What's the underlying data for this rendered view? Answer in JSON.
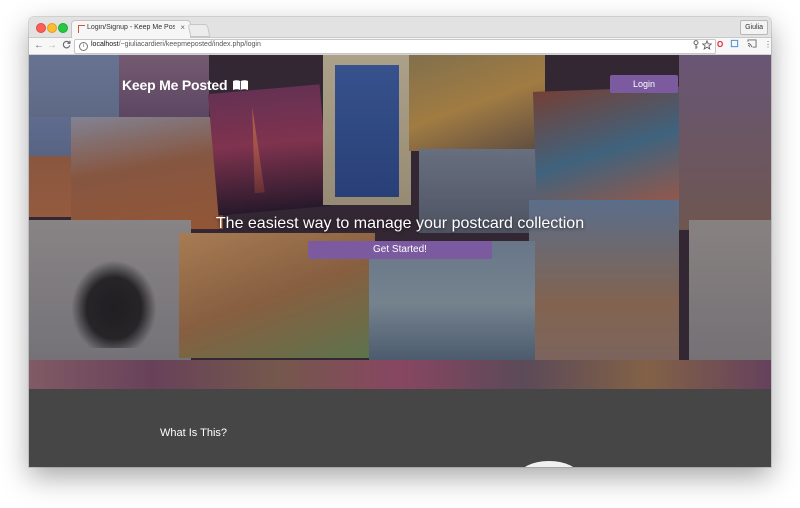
{
  "browser": {
    "tab_title": "Login/Signup - Keep Me Posted",
    "tab_close": "×",
    "user_name": "Giulia",
    "url_host": "localhost",
    "url_path": "/~giuliacardieri/keepmeposted/index.php/login",
    "nav": {
      "back": "←",
      "forward": "→",
      "reload": "C"
    }
  },
  "page": {
    "brand": "Keep Me Posted",
    "login_label": "Login",
    "tagline": "The easiest way to manage your postcard collection",
    "cta_label": "Get Started!",
    "section_title": "What Is This?"
  },
  "colors": {
    "accent": "#7b5aa0",
    "lower_bg": "#464646",
    "brand_text": "#ffffff"
  },
  "icons": {
    "brand": "open-book-icon",
    "info": "info-icon",
    "key": "key-icon",
    "bookmark": "star-icon",
    "opera": "opera-icon",
    "cast": "cast-icon",
    "menu": "kebab-menu-icon"
  }
}
